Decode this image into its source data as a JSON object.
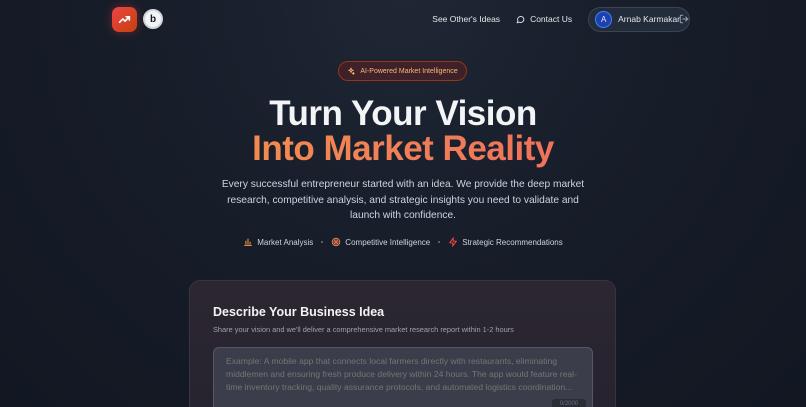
{
  "header": {
    "logo_icon": "trending-up-icon",
    "badge_letter": "b",
    "nav": {
      "see_others": "See Other's Ideas",
      "contact": "Contact Us",
      "contact_icon": "message-circle-icon"
    },
    "user": {
      "initial": "A",
      "name": "Arnab Karmakar"
    },
    "logout_icon": "logout-icon"
  },
  "hero": {
    "badge": "AI-Powered Market Intelligence",
    "badge_icon": "sparkles-icon",
    "title_line1": "Turn Your Vision",
    "title_line2": "Into Market Reality",
    "subtitle": "Every successful entrepreneur started with an idea. We provide the deep market research, competitive analysis, and strategic insights you need to validate and launch with confidence.",
    "features": [
      {
        "label": "Market Analysis",
        "icon": "bar-chart-icon"
      },
      {
        "label": "Competitive Intelligence",
        "icon": "target-icon"
      },
      {
        "label": "Strategic Recommendations",
        "icon": "zap-icon"
      }
    ]
  },
  "form": {
    "title": "Describe Your Business Idea",
    "subtitle": "Share your vision and we'll deliver a comprehensive market research report within 1-2 hours",
    "placeholder": "Example: A mobile app that connects local farmers directly with restaurants, eliminating middlemen and ensuring fresh produce delivery within 24 hours. The app would feature real-time inventory tracking, quality assurance protocols, and automated logistics coordination...",
    "counter": "0/2000"
  },
  "colors": {
    "accent_orange": "#f59e42",
    "accent_red": "#ef4444",
    "background": "#171d29"
  }
}
